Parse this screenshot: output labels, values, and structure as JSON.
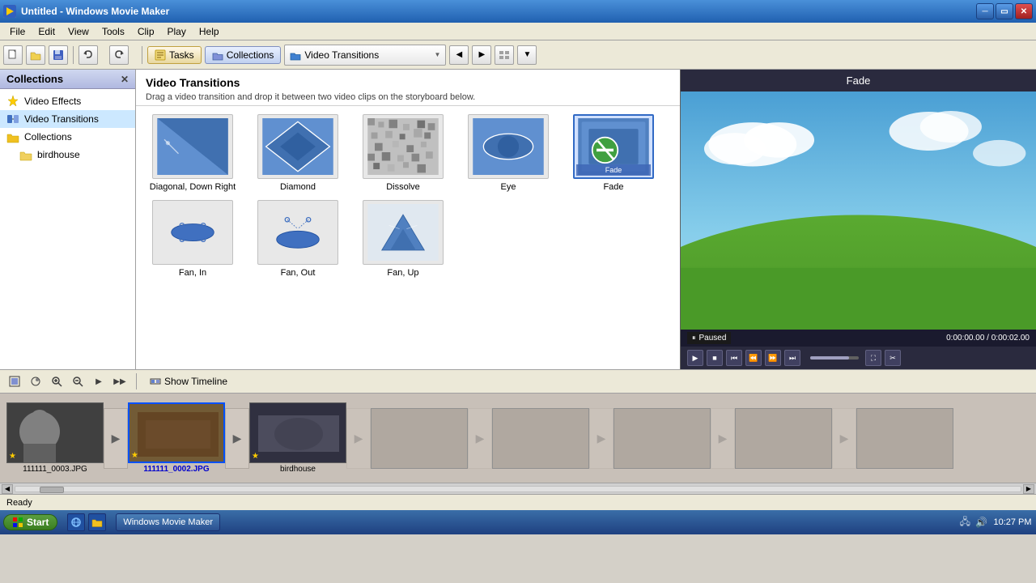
{
  "titlebar": {
    "title": "Untitled - Windows Movie Maker",
    "icon": "movie-maker-icon"
  },
  "menubar": {
    "items": [
      "File",
      "Edit",
      "View",
      "Tools",
      "Clip",
      "Play",
      "Help"
    ]
  },
  "toolbar": {
    "tasks_label": "Tasks",
    "collections_label": "Collections",
    "dropdown_label": "Video Transitions",
    "undo_label": "Undo",
    "redo_label": "Redo"
  },
  "sidebar": {
    "title": "Collections",
    "items": [
      {
        "label": "Video Effects",
        "icon": "star"
      },
      {
        "label": "Video Transitions",
        "icon": "transition"
      },
      {
        "label": "Collections",
        "icon": "folder"
      },
      {
        "label": "birdhouse",
        "icon": "folder-sub",
        "sub": true
      }
    ]
  },
  "content": {
    "title": "Video Transitions",
    "description": "Drag a video transition and drop it between two video clips on the storyboard below.",
    "transitions": [
      {
        "name": "Diagonal, Down Right",
        "shape": "diagonal"
      },
      {
        "name": "Diamond",
        "shape": "diamond"
      },
      {
        "name": "Dissolve",
        "shape": "dissolve"
      },
      {
        "name": "Eye",
        "shape": "eye"
      },
      {
        "name": "Fade",
        "shape": "fade",
        "selected": true
      },
      {
        "name": "Fan, In",
        "shape": "fan_in"
      },
      {
        "name": "Fan, Out",
        "shape": "fan_out"
      },
      {
        "name": "Fan, Up",
        "shape": "fan_up"
      }
    ]
  },
  "preview": {
    "title": "Fade",
    "status": "Paused",
    "time_current": "0:00:00.00",
    "time_total": "0:00:02.00",
    "time_display": "0:00:00.00 / 0:00:02.00"
  },
  "storyboard": {
    "show_timeline_label": "Show Timeline",
    "clips": [
      {
        "label": "111111_0003.JPG",
        "selected": false
      },
      {
        "label": "111111_0002.JPG",
        "selected": true
      },
      {
        "label": "birdhouse",
        "selected": false
      }
    ]
  },
  "statusbar": {
    "text": "Ready"
  },
  "taskbar": {
    "start_label": "Start",
    "apps": [
      "Windows Movie Maker"
    ],
    "time": "10:27 PM"
  }
}
